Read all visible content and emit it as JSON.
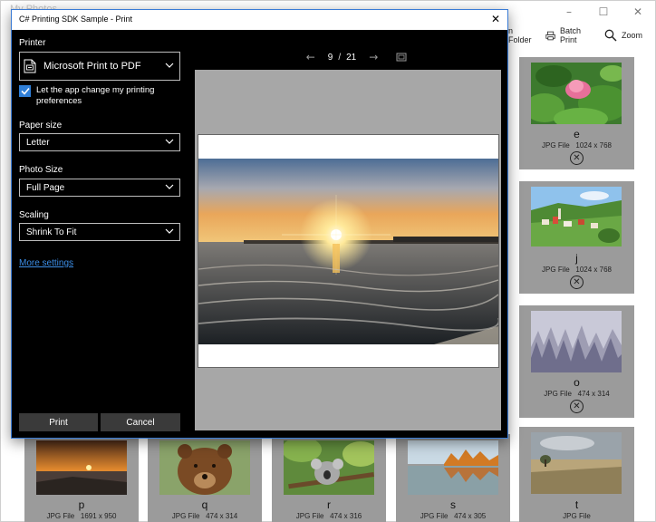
{
  "app": {
    "title": "My Photos",
    "window_controls": {
      "minimize": "–",
      "maximize": "☐",
      "close": "✕"
    },
    "toolbar": [
      {
        "label": "n Folder",
        "icon": "folder-icon"
      },
      {
        "label": "Batch Print",
        "icon": "printer-icon"
      },
      {
        "label": "Zoom",
        "icon": "search-icon"
      }
    ],
    "right_tiles": [
      {
        "name": "e",
        "info": "JPG File   1024 x 768",
        "remove": "✕"
      },
      {
        "name": "j",
        "info": "JPG File   1024 x 768",
        "remove": "✕"
      },
      {
        "name": "o",
        "info": "JPG File   474 x 314",
        "remove": "✕"
      }
    ],
    "bottom_tiles": [
      {
        "name": "p",
        "info": "JPG File   1691 x 950"
      },
      {
        "name": "q",
        "info": "JPG File   474 x 314"
      },
      {
        "name": "r",
        "info": "JPG File   474 x 316"
      },
      {
        "name": "s",
        "info": "JPG File   474 x 305"
      },
      {
        "name": "t",
        "info": "JPG File"
      }
    ]
  },
  "dialog": {
    "title": "C# Printing SDK Sample - Print",
    "close": "✕",
    "printer_label": "Printer",
    "printer_value": "Microsoft Print to PDF",
    "allow_prefs_label": "Let the app change my printing preferences",
    "allow_prefs_checked": true,
    "paper_size_label": "Paper size",
    "paper_size_value": "Letter",
    "photo_size_label": "Photo Size",
    "photo_size_value": "Full Page",
    "scaling_label": "Scaling",
    "scaling_value": "Shrink To Fit",
    "more_settings": "More settings",
    "print_button": "Print",
    "cancel_button": "Cancel",
    "preview": {
      "prev": "←",
      "next": "→",
      "current_page": "9",
      "separator": "/",
      "total_pages": "21"
    }
  },
  "colors": {
    "dialog_bg": "#000000",
    "accent": "#2f7fd8",
    "link": "#3c8fe8",
    "tile_bg": "#9b9b9b",
    "preview_bg": "#a7a7a7"
  }
}
